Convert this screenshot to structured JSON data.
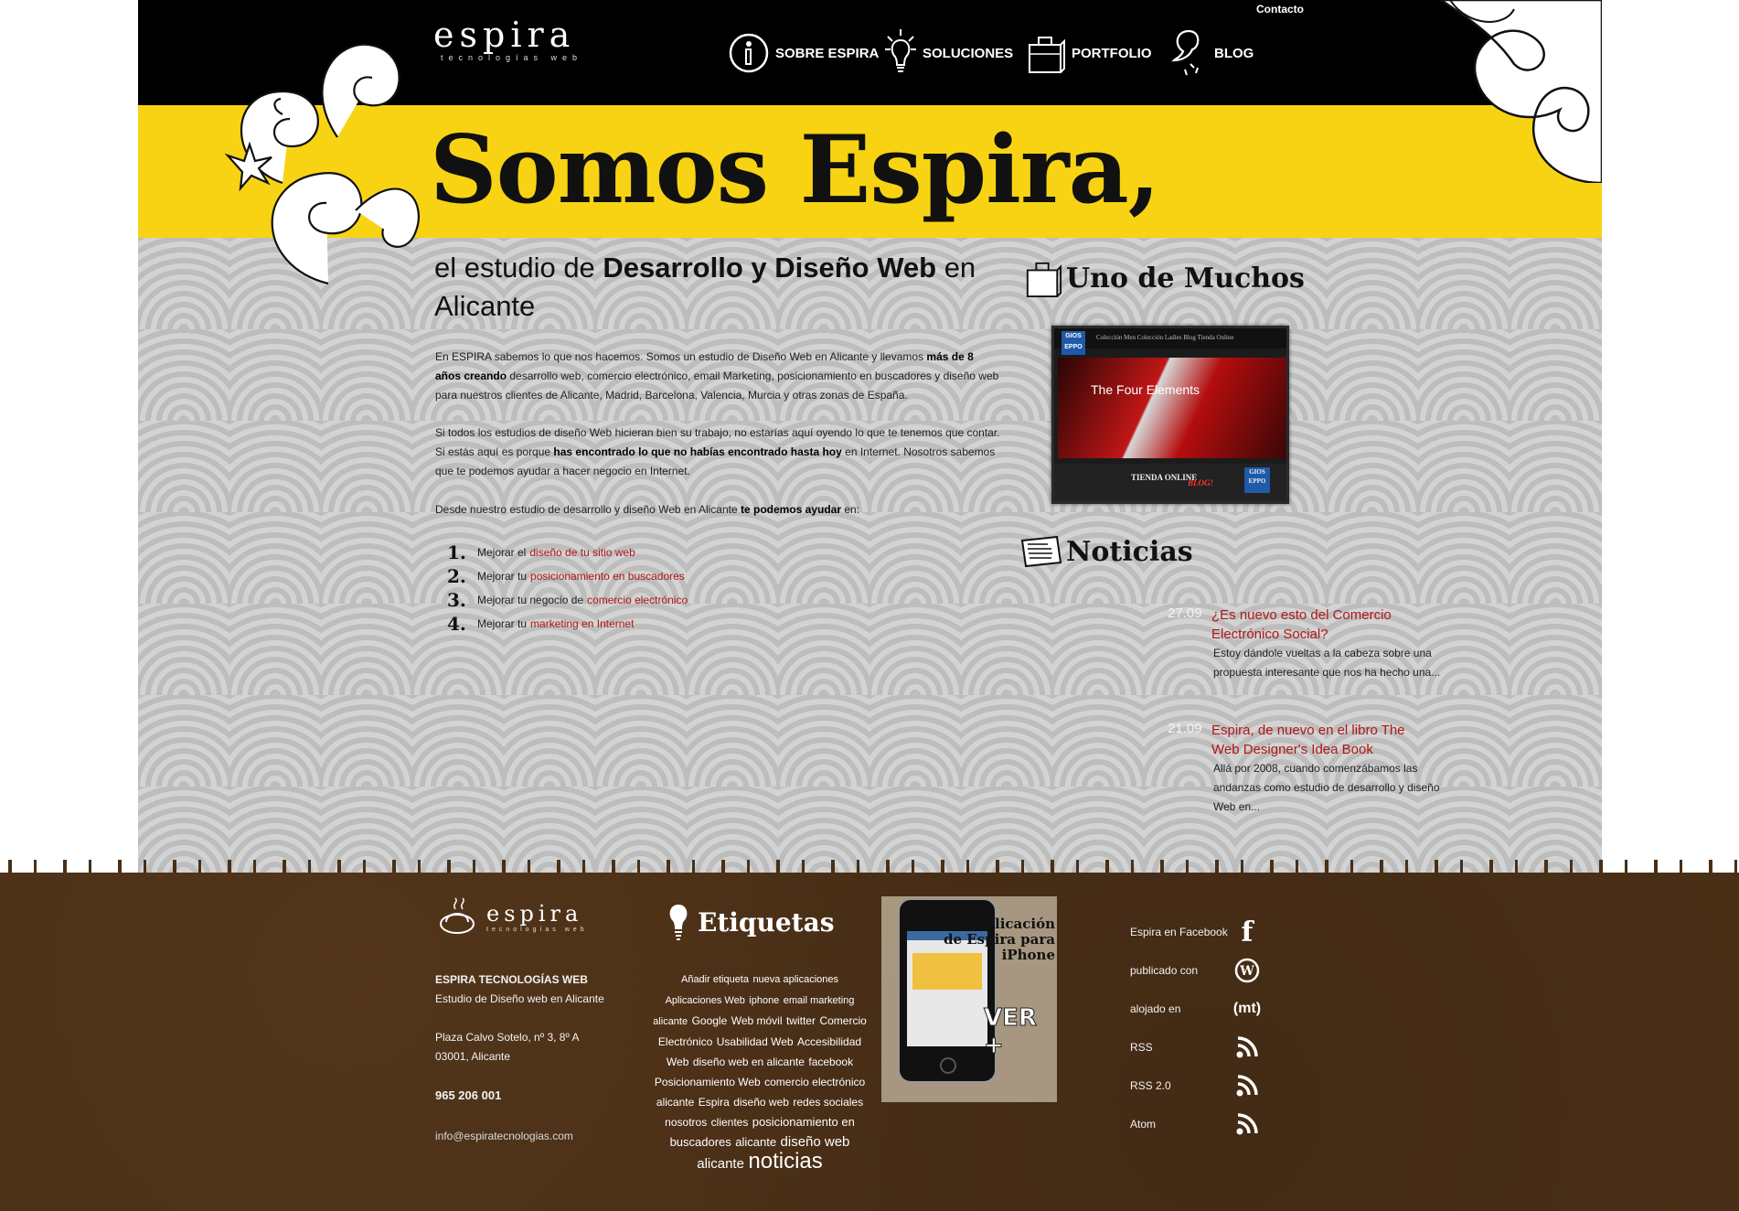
{
  "header": {
    "logo": {
      "word": "espira",
      "tagline": "tecnologías web"
    },
    "contact_label": "Contacto",
    "nav": [
      {
        "label": "SOBRE ESPIRA",
        "icon": "info-icon"
      },
      {
        "label": "SOLUCIONES",
        "icon": "lightbulb-icon"
      },
      {
        "label": "PORTFOLIO",
        "icon": "briefcase-icon"
      },
      {
        "label": "BLOG",
        "icon": "speech-icon"
      }
    ]
  },
  "hero": {
    "headline": "Somos Espira,",
    "sub_1": "el estudio de ",
    "sub_2": "Desarrollo y Diseño Web",
    "sub_3": " en Alicante"
  },
  "intro": {
    "p1a": "En ESPIRA sabemos lo que nos hacemos. Somos un estudio de Diseño Web en Alicante y llevamos ",
    "p1b": "más de 8 años creando",
    "p1c": " desarrollo web, comercio electrónico, email Marketing, posicionamiento en buscadores y diseño web para nuestros clientes de Alicante, Madrid, Barcelona, Valencia, Murcia y otras zonas de España.",
    "p2a": "Si todos los estudios de diseño Web hicieran bien su trabajo, no estarías aquí oyendo lo que te tenemos que contar. Si estás aquí es porque ",
    "p2b": "has encontrado lo que no habías encontrado hasta hoy",
    "p2c": " en Internet. Nosotros sabemos que te podemos ayudar a hacer negocio en Internet.",
    "p3a": "Desde nuestro estudio de desarrollo y diseño Web en Alicante ",
    "p3b": "te podemos ayudar",
    "p3c": " en:"
  },
  "benefits": [
    {
      "num": "1.",
      "prefix": "Mejorar el",
      "link": "diseño de tu sitio web"
    },
    {
      "num": "2.",
      "prefix": "Mejorar tu",
      "link": "posicionamiento en buscadores"
    },
    {
      "num": "3.",
      "prefix": "Mejorar tu negocio de",
      "link": "comercio electrónico"
    },
    {
      "num": "4.",
      "prefix": "Mejorar tu",
      "link": "marketing en Internet"
    }
  ],
  "portfolio": {
    "heading": "Uno de Muchos",
    "thumb": {
      "brand": "GIOS EPPO",
      "nav_text": "Colección Men   Colección Ladies   Blog   Tienda Online",
      "banner_text": "The Four Elements",
      "bottom_1": "TIENDA ONLINE",
      "bottom_2": "BLOG!",
      "bottom_brand": "GIOS EPPO"
    }
  },
  "news": {
    "heading": "Noticias",
    "items": [
      {
        "date": "27.09",
        "title": "¿Es nuevo esto del Comercio Electrónico Social?",
        "excerpt": "Estoy dándole vueltas a la cabeza sobre una propuesta interesante que nos ha hecho una..."
      },
      {
        "date": "21.09",
        "title": "Espira, de nuevo en el libro The Web Designer's Idea Book",
        "excerpt": "Allá por 2008, cuando comenzábamos las andanzas como estudio de desarrollo y diseño Web en..."
      }
    ]
  },
  "footer": {
    "logo": {
      "word": "espira",
      "tagline": "tecnologías web"
    },
    "company": "ESPIRA TECNOLOGÍAS WEB",
    "company_sub": "Estudio de Diseño web en Alicante",
    "address_1": "Plaza Calvo Sotelo, nº 3, 8º A",
    "address_2": "03001, Alicante",
    "phone": "965 206 001",
    "email": "info@espiratecnologias.com",
    "tags_heading": "Etiquetas",
    "tags": [
      {
        "t": "Añadir etiqueta",
        "s": 11
      },
      {
        "t": "nueva aplicaciones",
        "s": 11
      },
      {
        "t": "Aplicaciones Web",
        "s": 11
      },
      {
        "t": "iphone",
        "s": 11
      },
      {
        "t": "email marketing",
        "s": 11
      },
      {
        "t": "alicante",
        "s": 11
      },
      {
        "t": "Google",
        "s": 12
      },
      {
        "t": "Web móvil",
        "s": 12
      },
      {
        "t": "twitter",
        "s": 12
      },
      {
        "t": "Comercio Electrónico",
        "s": 12
      },
      {
        "t": "Usabilidad Web",
        "s": 12
      },
      {
        "t": "Accesibilidad Web",
        "s": 12
      },
      {
        "t": "diseño web en alicante",
        "s": 12
      },
      {
        "t": "facebook",
        "s": 12
      },
      {
        "t": "Posicionamiento Web",
        "s": 12
      },
      {
        "t": "comercio electrónico alicante",
        "s": 12
      },
      {
        "t": "Espira",
        "s": 12
      },
      {
        "t": "diseño web",
        "s": 12
      },
      {
        "t": "redes sociales",
        "s": 12
      },
      {
        "t": "nosotros",
        "s": 12
      },
      {
        "t": "clientes",
        "s": 12
      },
      {
        "t": "posicionamiento en buscadores",
        "s": 13
      },
      {
        "t": "alicante",
        "s": 13
      },
      {
        "t": "diseño web alicante",
        "s": 15
      },
      {
        "t": "noticias",
        "s": 24
      }
    ],
    "iphone_promo": {
      "title": "La Aplicación de Espira para iPhone",
      "cta": "VER +"
    },
    "social": [
      {
        "label": "Espira en Facebook",
        "icon": "facebook-icon",
        "glyph": "f"
      },
      {
        "label": "publicado con",
        "icon": "wordpress-icon",
        "glyph": "W"
      },
      {
        "label": "alojado en",
        "icon": "mt-icon",
        "glyph": "(mt)"
      },
      {
        "label": "RSS",
        "icon": "rss-icon",
        "glyph": ""
      },
      {
        "label": "RSS 2.0",
        "icon": "rss-icon",
        "glyph": ""
      },
      {
        "label": "Atom",
        "icon": "rss-icon",
        "glyph": ""
      }
    ]
  }
}
